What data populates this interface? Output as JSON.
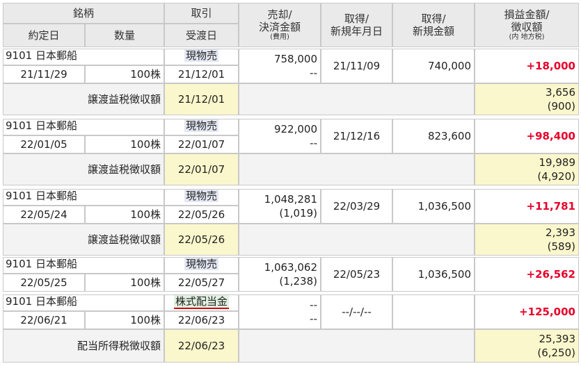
{
  "header": {
    "brand": "銘柄",
    "trade": "取引",
    "sell_line1": "売却/",
    "sell_line2": "決済金額",
    "sell_sub": "(費用)",
    "acq_date_line1": "取得/",
    "acq_date_line2": "新規年月日",
    "acq_amt_line1": "取得/",
    "acq_amt_line2": "新規金額",
    "pl_line1": "損益金額/",
    "pl_line2": "徴収額",
    "pl_sub": "(内 地方税)",
    "contract_date": "約定日",
    "quantity": "数量",
    "delivery_date": "受渡日"
  },
  "rows": [
    {
      "name": "9101 日本郵船",
      "trade": "現物売",
      "trade_kind": "sell",
      "sell_amount": "758,000",
      "fee": "--",
      "acq_date": "21/11/09",
      "acq_amount": "740,000",
      "pl": "+18,000",
      "contract_date": "21/11/29",
      "quantity": "100株",
      "delivery_date": "21/12/01",
      "tax": {
        "label": "譲渡益税徴収額",
        "date": "21/12/01",
        "amount": "3,656",
        "local": "(900)"
      }
    },
    {
      "name": "9101 日本郵船",
      "trade": "現物売",
      "trade_kind": "sell",
      "sell_amount": "922,000",
      "fee": "--",
      "acq_date": "21/12/16",
      "acq_amount": "823,600",
      "pl": "+98,400",
      "contract_date": "22/01/05",
      "quantity": "100株",
      "delivery_date": "22/01/07",
      "tax": {
        "label": "譲渡益税徴収額",
        "date": "22/01/07",
        "amount": "19,989",
        "local": "(4,920)"
      }
    },
    {
      "name": "9101 日本郵船",
      "trade": "現物売",
      "trade_kind": "sell",
      "sell_amount": "1,048,281",
      "fee": "(1,019)",
      "acq_date": "22/03/29",
      "acq_amount": "1,036,500",
      "pl": "+11,781",
      "contract_date": "22/05/24",
      "quantity": "100株",
      "delivery_date": "22/05/26",
      "tax": {
        "label": "譲渡益税徴収額",
        "date": "22/05/26",
        "amount": "2,393",
        "local": "(589)"
      }
    },
    {
      "name": "9101 日本郵船",
      "trade": "現物売",
      "trade_kind": "sell",
      "sell_amount": "1,063,062",
      "fee": "(1,238)",
      "acq_date": "22/05/23",
      "acq_amount": "1,036,500",
      "pl": "+26,562",
      "contract_date": "22/05/25",
      "quantity": "100株",
      "delivery_date": "22/05/27"
    },
    {
      "name": "9101 日本郵船",
      "trade": "株式配当金",
      "trade_kind": "dividend",
      "sell_amount": "--",
      "fee": "--",
      "acq_date": "--/--/--",
      "acq_amount": "",
      "pl": "+125,000",
      "contract_date": "22/06/21",
      "quantity": "100株",
      "delivery_date": "22/06/23",
      "tax": {
        "label": "配当所得税徴収額",
        "date": "22/06/23",
        "amount": "25,393",
        "local": "(6,250)"
      }
    }
  ]
}
